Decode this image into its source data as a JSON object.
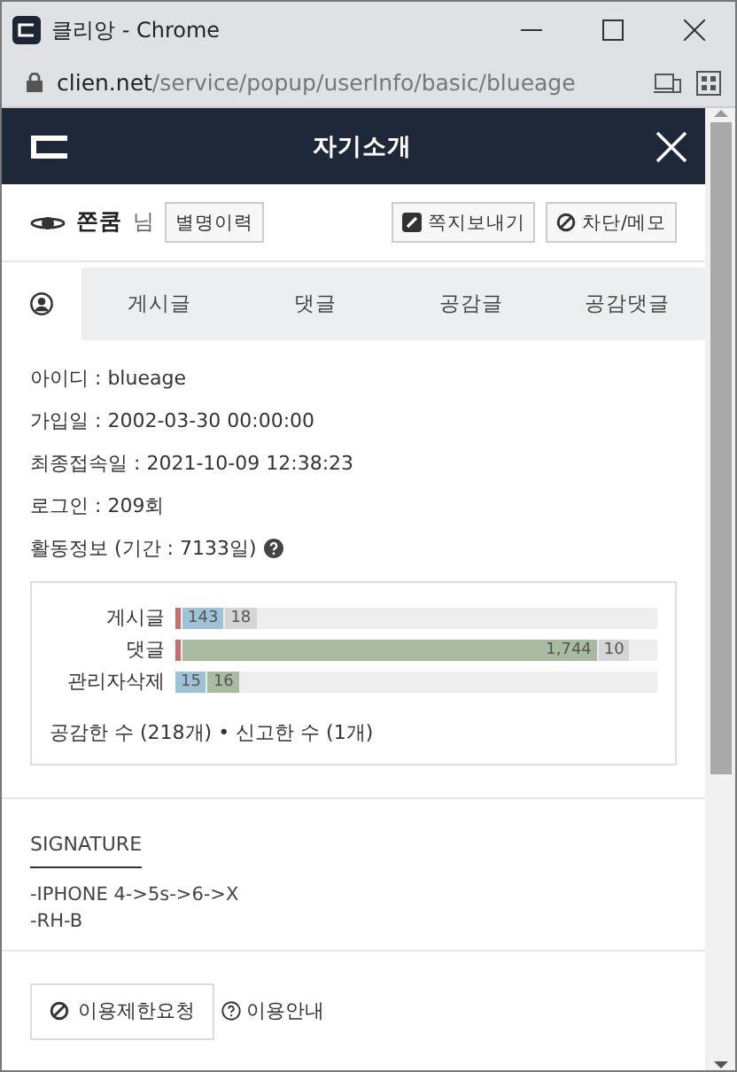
{
  "window": {
    "title": "클리앙 - Chrome",
    "url_host": "clien.net",
    "url_path": "/service/popup/userInfo/basic/blueage"
  },
  "header": {
    "title": "자기소개"
  },
  "profile": {
    "nickname": "쫀쿰",
    "suffix": "님",
    "history_button": "별명이력",
    "actions": [
      {
        "label": "쪽지보내기",
        "kind": "message"
      },
      {
        "label": "차단/메모",
        "kind": "block"
      }
    ]
  },
  "tabs": [
    {
      "kind": "profile",
      "selected": true
    },
    {
      "label": "게시글",
      "kind": "text",
      "selected": false
    },
    {
      "label": "댓글",
      "kind": "text",
      "selected": false
    },
    {
      "label": "공감글",
      "kind": "text",
      "selected": false
    },
    {
      "label": "공감댓글",
      "kind": "text",
      "selected": false
    }
  ],
  "info": [
    "아이디 : blueage",
    "가입일 : 2002-03-30 00:00:00",
    "최종접속일 : 2021-10-09 12:38:23",
    "로그인 : 209회"
  ],
  "activity_title": "활동정보 (기간 : 7133일)",
  "stats": [
    {
      "label": "게시글",
      "segments": [
        {
          "kind": "marker",
          "color": "#c0706f"
        },
        {
          "kind": "count",
          "text": "143",
          "color": "#9fc3d6"
        },
        {
          "kind": "count",
          "text": "18",
          "color": "#d5d5d5"
        }
      ]
    },
    {
      "label": "댓글",
      "segments": [
        {
          "kind": "marker",
          "color": "#c0706f"
        },
        {
          "kind": "wide",
          "text": "1,744",
          "color": "#a8bba0"
        },
        {
          "kind": "count",
          "text": "10",
          "color": "#d5d5d5"
        }
      ]
    },
    {
      "label": "관리자삭제",
      "segments": [
        {
          "kind": "count",
          "text": "15",
          "color": "#9fc3d6"
        },
        {
          "kind": "count",
          "text": "16",
          "color": "#a8bba0"
        }
      ]
    }
  ],
  "stats_summary": "공감한 수 (218개) • 신고한 수 (1개)",
  "signature": {
    "title": "SIGNATURE",
    "lines": [
      "-IPHONE 4->5s->6->X",
      "-RH-B"
    ]
  },
  "footer": {
    "report_button": "이용제한요청",
    "help_link": "이용안내"
  }
}
